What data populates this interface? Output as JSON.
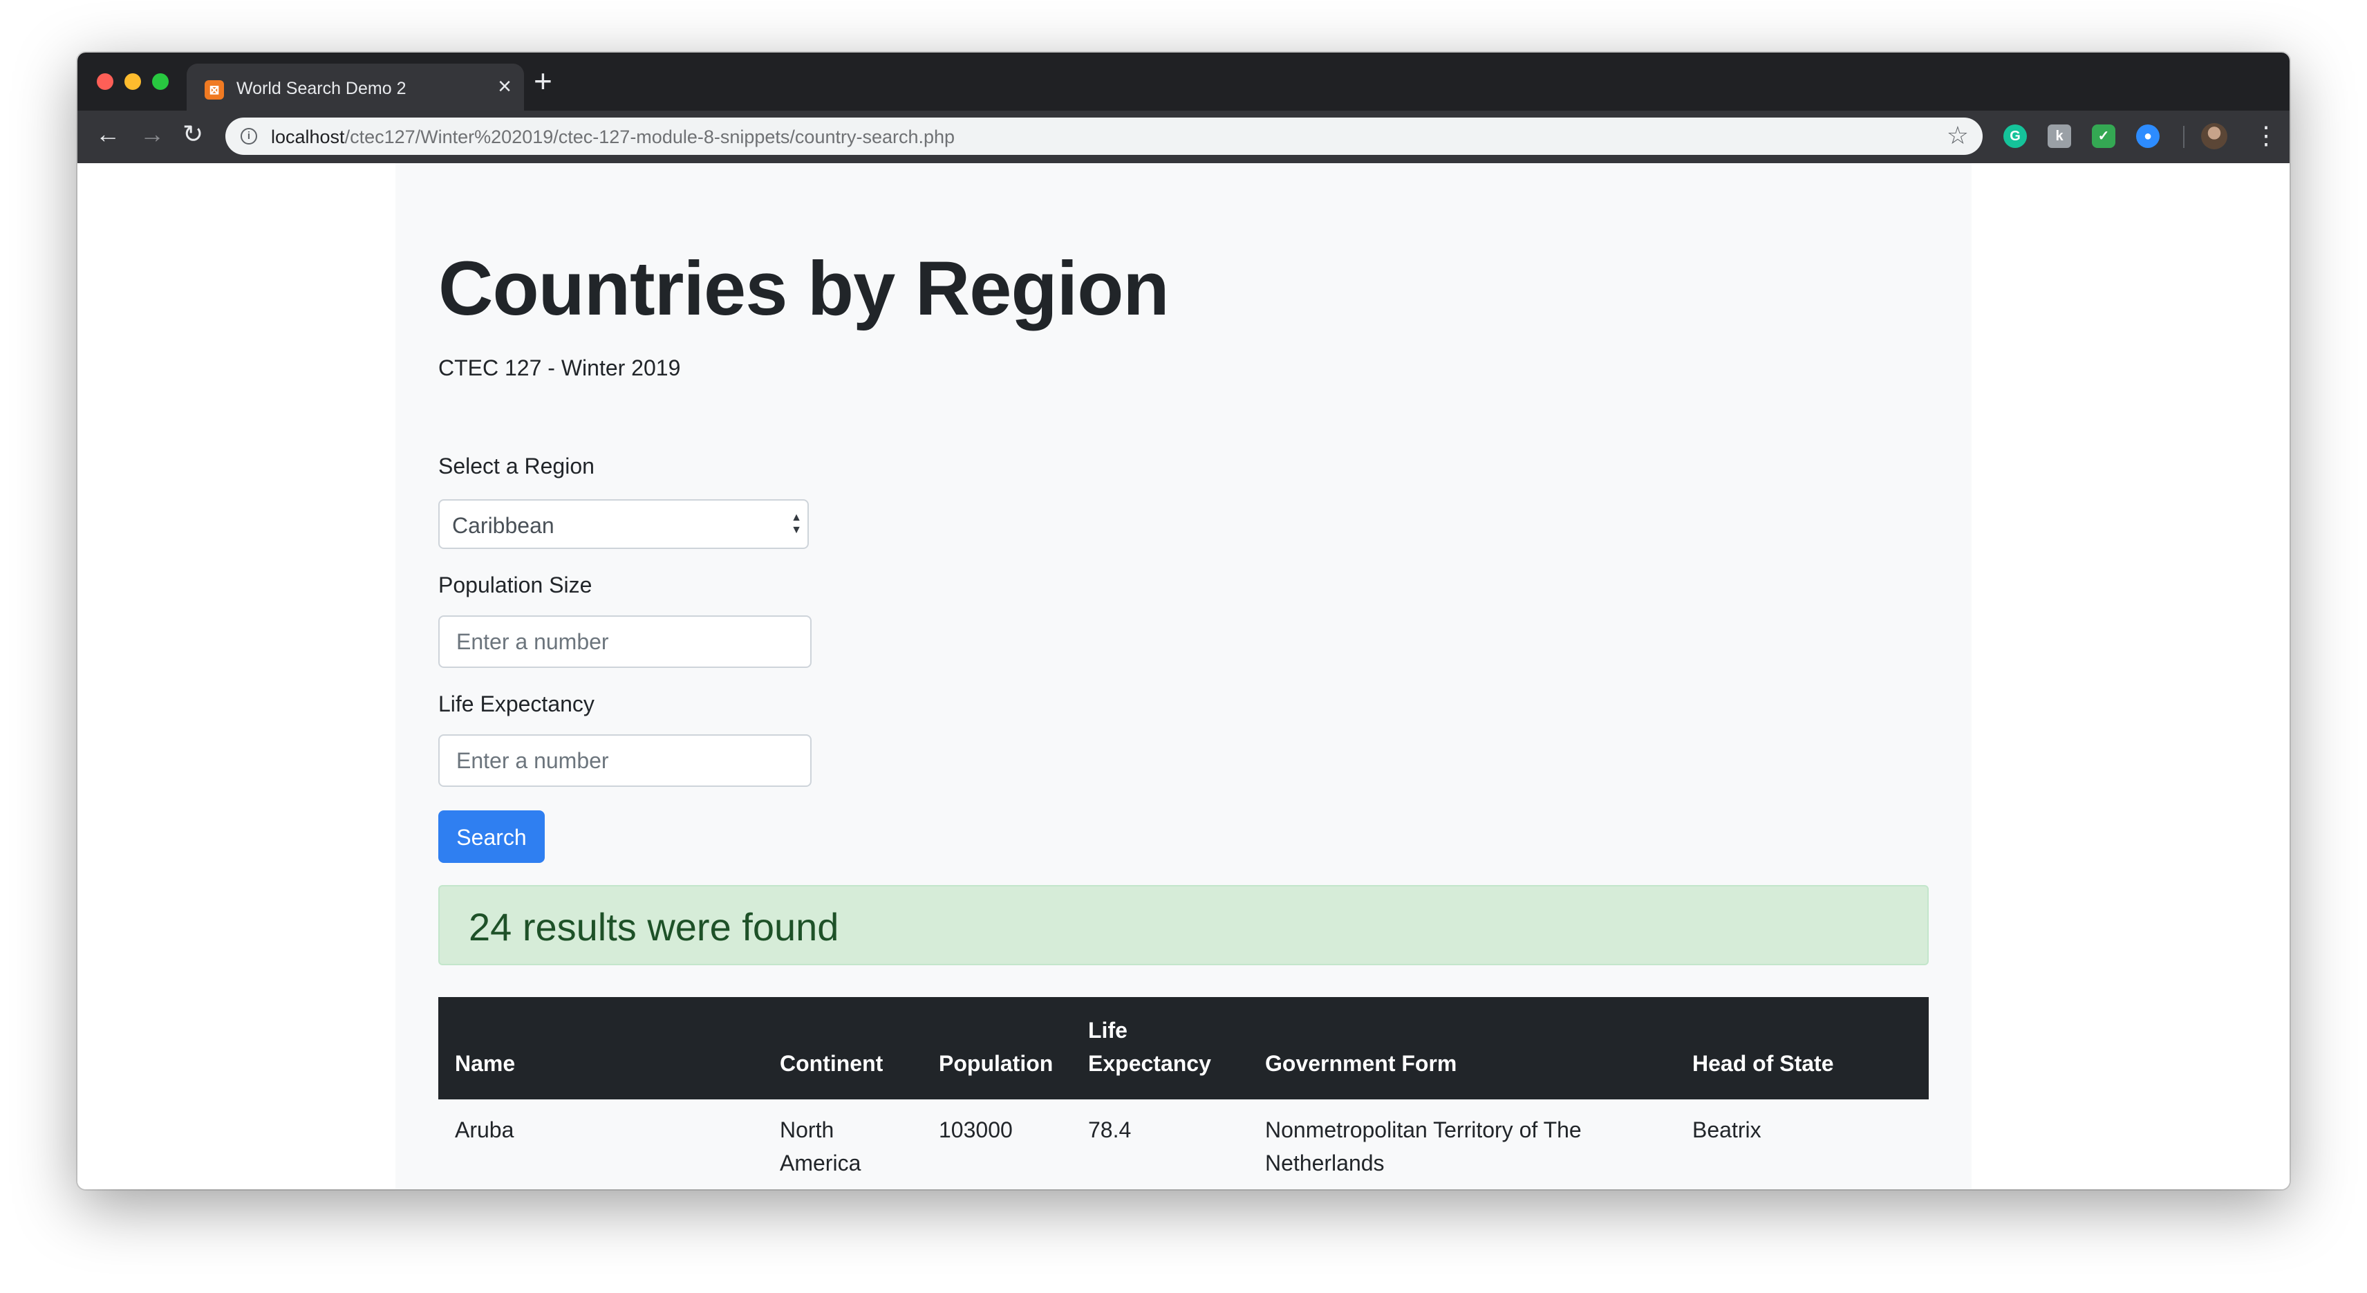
{
  "browser": {
    "tab_title": "World Search Demo 2",
    "new_tab_symbol": "+",
    "url_host": "localhost",
    "url_path": "/ctec127/Winter%202019/ctec-127-module-8-snippets/country-search.php"
  },
  "page": {
    "title": "Countries by Region",
    "subtitle": "CTEC 127 - Winter 2019"
  },
  "form": {
    "region_label": "Select a Region",
    "region_selected": "Caribbean",
    "population_label": "Population Size",
    "population_placeholder": "Enter a number",
    "life_label": "Life Expectancy",
    "life_placeholder": "Enter a number",
    "search_button": "Search"
  },
  "alert": {
    "message": "24 results were found",
    "color": "#d6ecd8"
  },
  "table": {
    "headers": {
      "name": "Name",
      "continent": "Continent",
      "population": "Population",
      "life_line1": "Life",
      "life_line2": "Expectancy",
      "government": "Government Form",
      "head": "Head of State"
    },
    "rows": [
      {
        "name": "Aruba",
        "continent_line1": "North",
        "continent_line2": "America",
        "population": "103000",
        "life": "78.4",
        "government_line1": "Nonmetropolitan Territory of The",
        "government_line2": "Netherlands",
        "head": "Beatrix"
      }
    ]
  },
  "colors": {
    "accent": "#2f7ff1",
    "table_header": "#212529",
    "container_bg": "#f8f9fa"
  }
}
